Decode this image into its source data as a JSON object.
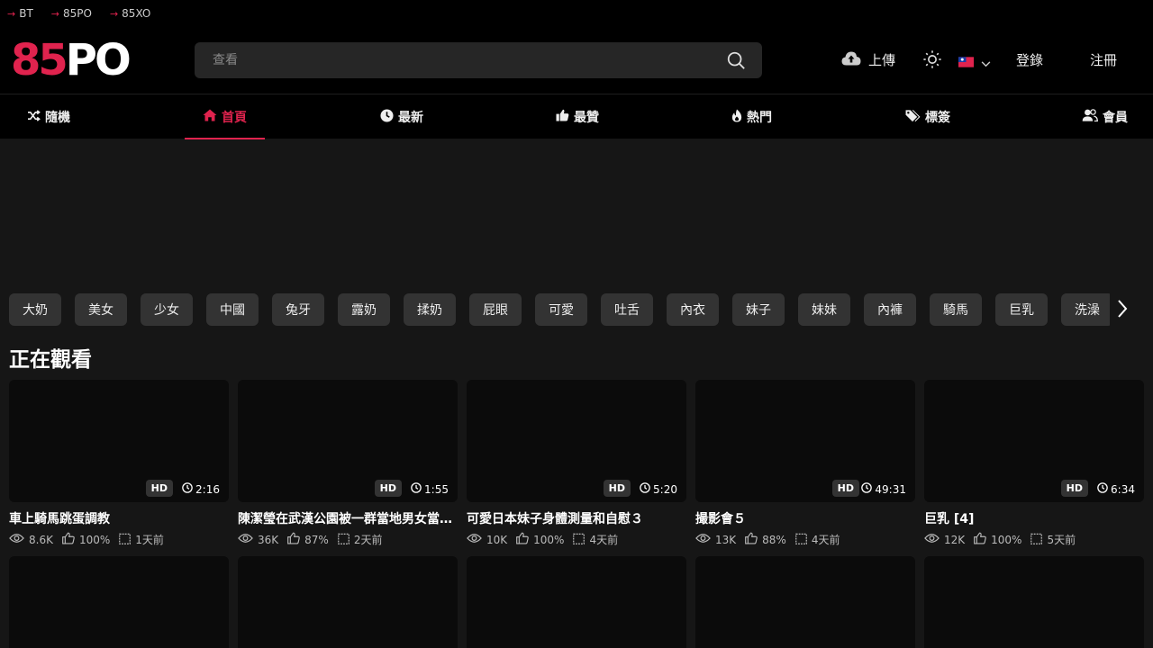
{
  "topbar": {
    "links": [
      {
        "label": "BT"
      },
      {
        "label": "85PO"
      },
      {
        "label": "85XO"
      }
    ]
  },
  "logo": {
    "part1": "85",
    "part2": "PO"
  },
  "search": {
    "placeholder": "查看"
  },
  "header": {
    "upload_label": "上傳",
    "login_label": "登錄",
    "register_label": "注冊"
  },
  "nav": {
    "items": [
      {
        "label": "隨機",
        "icon": "shuffle-icon"
      },
      {
        "label": "首頁",
        "icon": "home-icon"
      },
      {
        "label": "最新",
        "icon": "clock-icon"
      },
      {
        "label": "最贊",
        "icon": "thumbs-up-icon"
      },
      {
        "label": "熱門",
        "icon": "fire-icon"
      },
      {
        "label": "標簽",
        "icon": "tags-icon"
      },
      {
        "label": "會員",
        "icon": "users-icon"
      }
    ],
    "active": "首頁"
  },
  "tags": [
    "大奶",
    "美女",
    "少女",
    "中國",
    "兔牙",
    "露奶",
    "揉奶",
    "屁眼",
    "可愛",
    "吐舌",
    "內衣",
    "妹子",
    "妹妹",
    "內褲",
    "騎馬",
    "巨乳",
    "洗澡"
  ],
  "section": {
    "title": "正在觀看"
  },
  "videos": [
    {
      "title": "車上騎馬跳蛋調教",
      "quality": "HD",
      "duration": "2:16",
      "views": "8.6K",
      "rating": "100%",
      "date": "1天前"
    },
    {
      "title": "陳潔瑩在武漢公園被一群當地男女當眾羞辱",
      "quality": "HD",
      "duration": "1:55",
      "views": "36K",
      "rating": "87%",
      "date": "2天前"
    },
    {
      "title": "可愛日本妹子身體測量和自慰３",
      "quality": "HD",
      "duration": "5:20",
      "views": "10K",
      "rating": "100%",
      "date": "4天前"
    },
    {
      "title": "撮影會５",
      "quality": "HD",
      "duration": "49:31",
      "views": "13K",
      "rating": "88%",
      "date": "4天前"
    },
    {
      "title": "巨乳 [4]",
      "quality": "HD",
      "duration": "6:34",
      "views": "12K",
      "rating": "100%",
      "date": "5天前"
    }
  ],
  "colors": {
    "accent": "#e0234e",
    "background": "#161616",
    "header": "#000000"
  }
}
